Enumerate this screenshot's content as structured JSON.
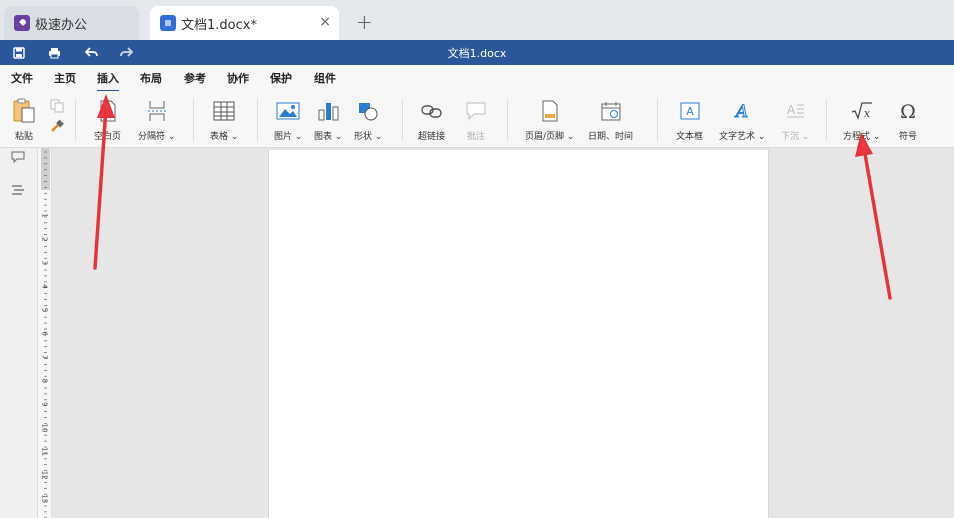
{
  "tabs": [
    {
      "label": "极速办公"
    },
    {
      "label": "文档1.docx*"
    }
  ],
  "new_tab_symbol": "+",
  "close_symbol": "×",
  "window": {
    "title": "文档1.docx"
  },
  "menu": {
    "items": [
      "文件",
      "主页",
      "插入",
      "布局",
      "参考",
      "协作",
      "保护",
      "组件"
    ],
    "active": "插入"
  },
  "ribbon": {
    "paste": "粘贴",
    "blank_page": "空白页",
    "separator": "分隔符",
    "table": "表格",
    "picture": "图片",
    "chart": "图表",
    "shape": "形状",
    "hyperlink": "超链接",
    "comment": "批注",
    "header_footer": "页眉/页脚",
    "datetime": "日期、时间",
    "textbox": "文本框",
    "wordart": "文字艺术",
    "dropcap": "下沉",
    "equation": "方程式",
    "symbol": "符号"
  },
  "ruler_numbers": [
    "1",
    "2",
    "3",
    "4",
    "5",
    "6",
    "7",
    "8",
    "9",
    "10",
    "11",
    "12",
    "13"
  ],
  "colors": {
    "titlebar": "#2b579a",
    "annotation_arrow": "#e8323c",
    "app_icon": "#6b3fa0",
    "doc_icon": "#2f6fd6"
  }
}
